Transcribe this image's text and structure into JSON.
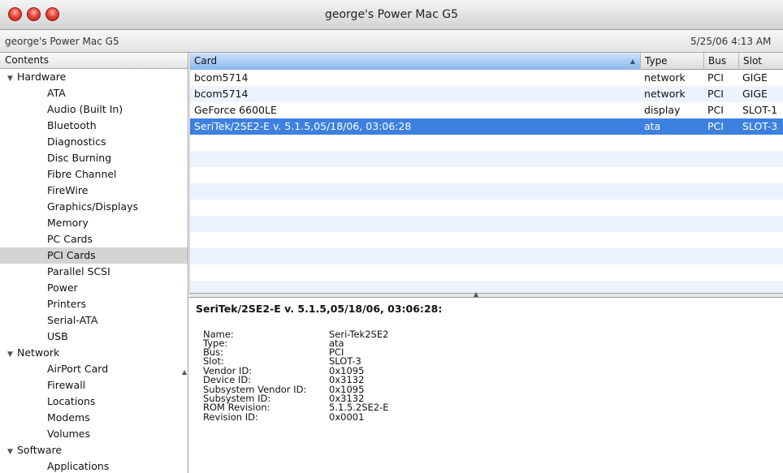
{
  "window": {
    "title": "george's Power Mac G5",
    "traffic_lights": [
      {
        "name": "close",
        "color": "#e8473a"
      },
      {
        "name": "minimize",
        "color": "#e8473a"
      },
      {
        "name": "zoom",
        "color": "#e8473a"
      }
    ]
  },
  "infobar": {
    "machine_name": "george's Power Mac G5",
    "timestamp": "5/25/06 4:13 AM"
  },
  "sidebar": {
    "header": "Contents",
    "groups": [
      {
        "label": "Hardware",
        "expanded": true,
        "items": [
          {
            "label": "ATA"
          },
          {
            "label": "Audio (Built In)"
          },
          {
            "label": "Bluetooth"
          },
          {
            "label": "Diagnostics"
          },
          {
            "label": "Disc Burning"
          },
          {
            "label": "Fibre Channel"
          },
          {
            "label": "FireWire"
          },
          {
            "label": "Graphics/Displays"
          },
          {
            "label": "Memory"
          },
          {
            "label": "PC Cards"
          },
          {
            "label": "PCI Cards",
            "selected": true
          },
          {
            "label": "Parallel SCSI"
          },
          {
            "label": "Power"
          },
          {
            "label": "Printers"
          },
          {
            "label": "Serial-ATA"
          },
          {
            "label": "USB"
          }
        ]
      },
      {
        "label": "Network",
        "expanded": true,
        "items": [
          {
            "label": "AirPort Card"
          },
          {
            "label": "Firewall"
          },
          {
            "label": "Locations"
          },
          {
            "label": "Modems"
          },
          {
            "label": "Volumes"
          }
        ]
      },
      {
        "label": "Software",
        "expanded": true,
        "items": [
          {
            "label": "Applications"
          }
        ]
      }
    ]
  },
  "table": {
    "columns": [
      {
        "key": "card",
        "label": "Card",
        "sorted": true
      },
      {
        "key": "type",
        "label": "Type"
      },
      {
        "key": "bus",
        "label": "Bus"
      },
      {
        "key": "slot",
        "label": "Slot"
      }
    ],
    "rows": [
      {
        "card": "bcom5714",
        "type": "network",
        "bus": "PCI",
        "slot": "GIGE"
      },
      {
        "card": "bcom5714",
        "type": "network",
        "bus": "PCI",
        "slot": "GIGE"
      },
      {
        "card": "GeForce 6600LE",
        "type": "display",
        "bus": "PCI",
        "slot": "SLOT-1"
      },
      {
        "card": "SeriTek/2SE2-E v. 5.1.5,05/18/06, 03:06:28",
        "type": "ata",
        "bus": "PCI",
        "slot": "SLOT-3",
        "selected": true
      }
    ],
    "empty_rows": 10,
    "colors": {
      "selection": "#3d80df",
      "stripe": "#edf3fe"
    }
  },
  "detail": {
    "title": "SeriTek/2SE2-E v. 5.1.5,05/18/06, 03:06:28:",
    "fields": [
      {
        "label": "Name:",
        "value": "Seri-Tek2SE2"
      },
      {
        "label": "Type:",
        "value": "ata"
      },
      {
        "label": "Bus:",
        "value": "PCI"
      },
      {
        "label": "Slot:",
        "value": "SLOT-3"
      },
      {
        "label": "Vendor ID:",
        "value": "0x1095"
      },
      {
        "label": "Device ID:",
        "value": "0x3132"
      },
      {
        "label": "Subsystem Vendor ID:",
        "value": "0x1095"
      },
      {
        "label": "Subsystem ID:",
        "value": "0x3132"
      },
      {
        "label": "ROM Revision:",
        "value": "5.1.5.2SE2-E"
      },
      {
        "label": "Revision ID:",
        "value": "0x0001"
      }
    ]
  }
}
